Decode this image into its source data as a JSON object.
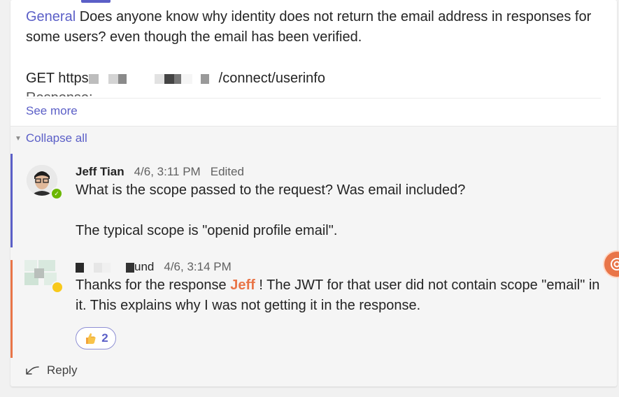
{
  "post": {
    "channel": "General",
    "text": "Does anyone know why identity does not return the email address in responses for some users? even though the email has been verified.",
    "url_prefix": "GET https",
    "url_suffix": "/connect/userinfo",
    "truncated_line": "Response:",
    "see_more": "See more"
  },
  "thread": {
    "collapse_label": "Collapse all",
    "reply_label": "Reply"
  },
  "messages": [
    {
      "author": "Jeff Tian",
      "time": "4/6, 3:11 PM",
      "edited": "Edited",
      "line1": "What is the scope passed to the request? Was email included?",
      "line2": "The typical scope is \"openid profile email\"."
    },
    {
      "author_partial": "und",
      "time": "4/6, 3:14 PM",
      "text_before": "Thanks for the response",
      "mention": "Jeff",
      "text_after": "! The JWT for that user did not contain scope \"email\" in it. This explains why I was not getting it in the response.",
      "reaction_count": "2"
    }
  ],
  "colors": {
    "accent": "#5b5fc7",
    "mention": "#e97548",
    "presence_available": "#6bb700",
    "presence_away": "#f8c91b"
  },
  "icons": [
    "collapse-triangle-icon",
    "reply-icon",
    "thumbs-up-emoji-icon",
    "available-presence-icon",
    "away-presence-icon",
    "copilot-icon"
  ]
}
